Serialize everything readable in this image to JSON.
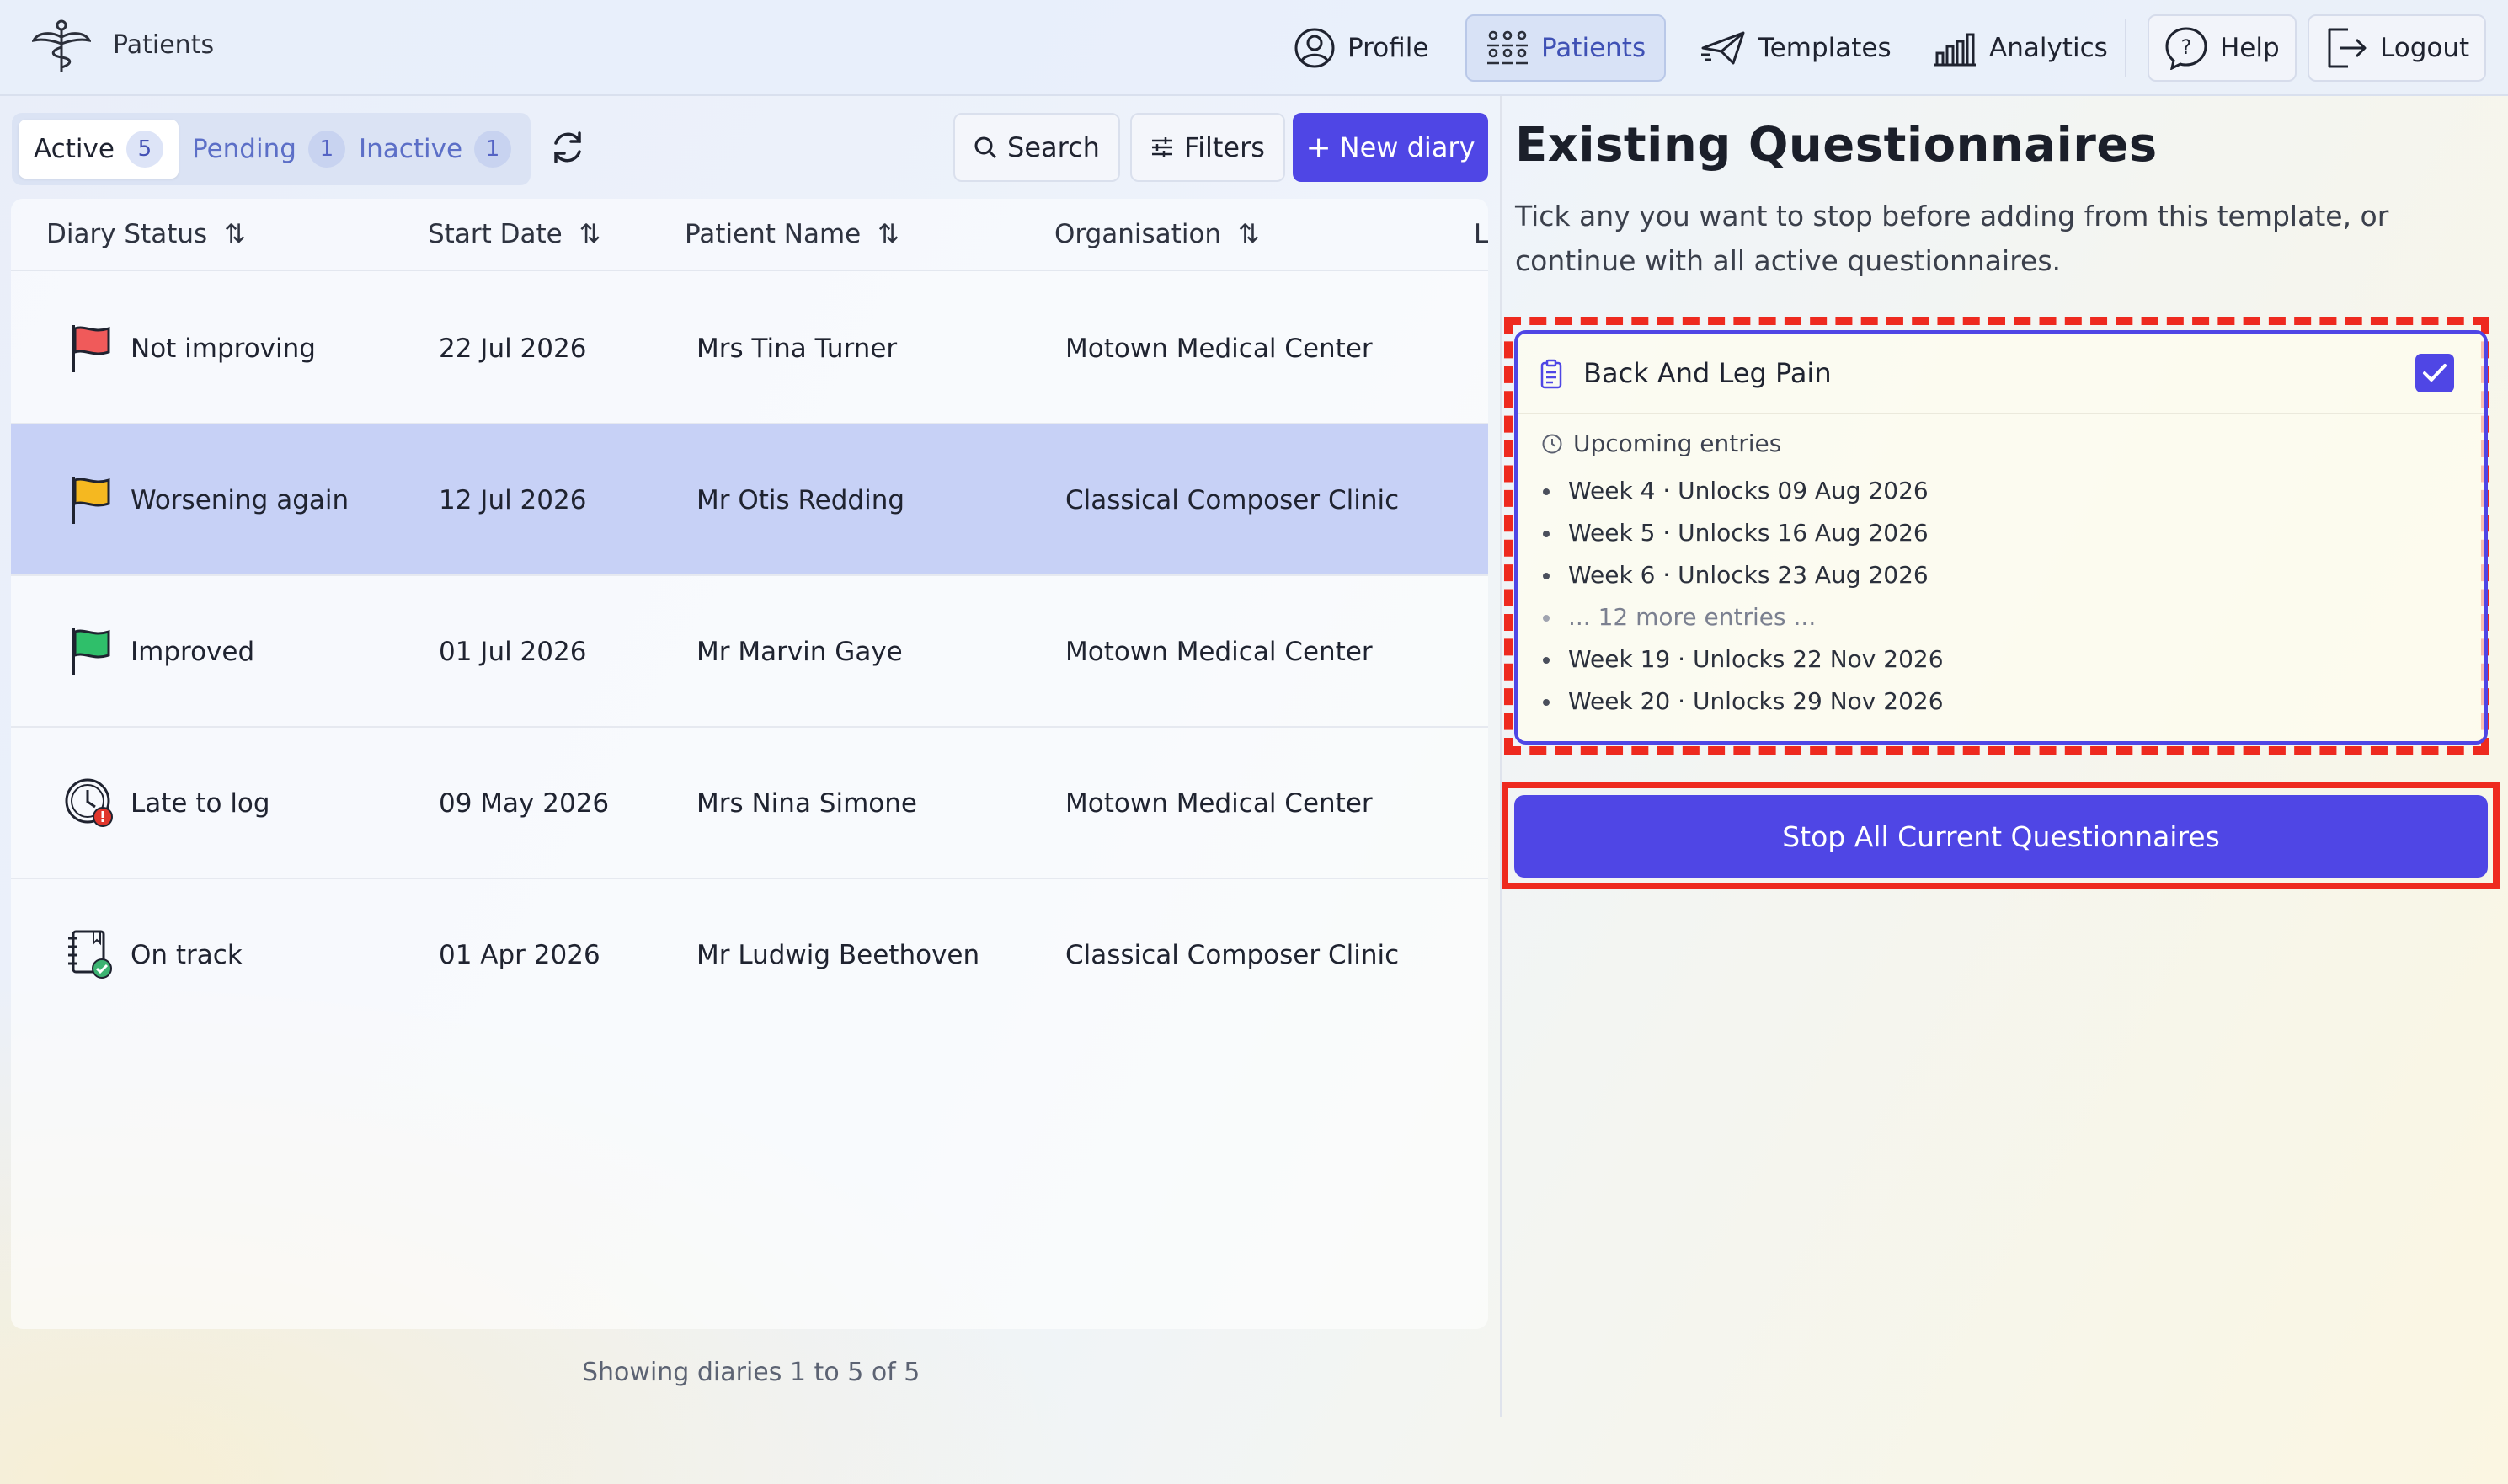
{
  "app": {
    "title": "Patients"
  },
  "nav": {
    "profile": "Profile",
    "patients": "Patients",
    "templates": "Templates",
    "analytics": "Analytics",
    "help": "Help",
    "logout": "Logout"
  },
  "tabs": [
    {
      "label": "Active",
      "count": "5"
    },
    {
      "label": "Pending",
      "count": "1"
    },
    {
      "label": "Inactive",
      "count": "1"
    }
  ],
  "toolbar": {
    "search": "Search",
    "filters": "Filters",
    "new_diary": "New diary"
  },
  "table": {
    "columns": [
      "Diary Status",
      "Start Date",
      "Patient Name",
      "Organisation",
      "L"
    ],
    "rows": [
      {
        "status": "Not improving",
        "status_icon": "red-flag-icon",
        "start_date": "22 Jul 2026",
        "patient": "Mrs Tina Turner",
        "organisation": "Motown Medical Center"
      },
      {
        "status": "Worsening again",
        "status_icon": "yellow-flag-icon",
        "start_date": "12 Jul 2026",
        "patient": "Mr Otis Redding",
        "organisation": "Classical Composer Clinic"
      },
      {
        "status": "Improved",
        "status_icon": "green-flag-icon",
        "start_date": "01 Jul 2026",
        "patient": "Mr Marvin Gaye",
        "organisation": "Motown Medical Center"
      },
      {
        "status": "Late to log",
        "status_icon": "late-clock-icon",
        "start_date": "09 May 2026",
        "patient": "Mrs Nina Simone",
        "organisation": "Motown Medical Center"
      },
      {
        "status": "On track",
        "status_icon": "notebook-check-icon",
        "start_date": "01 Apr 2026",
        "patient": "Mr Ludwig Beethoven",
        "organisation": "Classical Composer Clinic"
      }
    ],
    "selected_row": 1,
    "footer": "Showing diaries 1 to 5 of 5"
  },
  "panel": {
    "title": "Existing Questionnaires",
    "description": "Tick any you want to stop before adding from this template, or continue with all active questionnaires.",
    "questionnaire": {
      "name": "Back And Leg Pain",
      "checked": true,
      "upcoming_label": "Upcoming entries",
      "entries": [
        "Week 4 · Unlocks 09 Aug 2026",
        "Week 5 · Unlocks 16 Aug 2026",
        "Week 6 · Unlocks 23 Aug 2026",
        "... 12 more entries ...",
        "Week 19 · Unlocks 22 Nov 2026",
        "Week 20 · Unlocks 29 Nov 2026"
      ]
    },
    "stop_button": "Stop All Current Questionnaires"
  },
  "colors": {
    "accent": "#4f46e5",
    "highlight_red": "#ee2a1f",
    "selected_row": "#c7d1f6",
    "flag_red": "#f05a5a",
    "flag_yellow": "#f5b820",
    "flag_green": "#2fbf6a"
  }
}
